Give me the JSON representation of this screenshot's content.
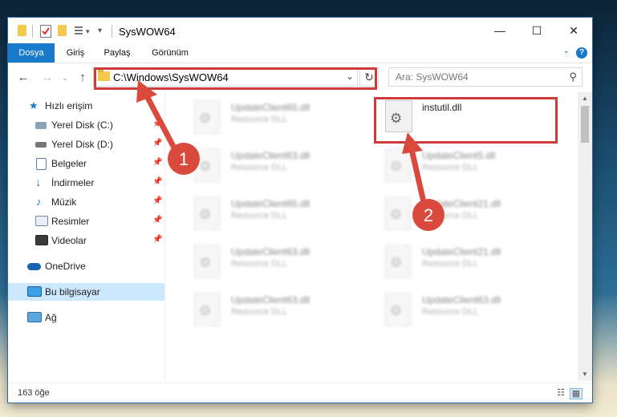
{
  "window": {
    "title": "SysWOW64",
    "controls": {
      "minimize": "—",
      "maximize": "☐",
      "close": "✕"
    }
  },
  "ribbon": {
    "tabs": [
      "Dosya",
      "Giriş",
      "Paylaş",
      "Görünüm"
    ],
    "help": "?"
  },
  "navigation": {
    "address": "C:\\Windows\\SysWOW64",
    "search_placeholder": "Ara: SysWOW64"
  },
  "sidebar": {
    "items": [
      {
        "label": "Hızlı erişim",
        "icon": "star-icon",
        "pinned": false
      },
      {
        "label": "Yerel Disk (C:)",
        "icon": "drive-icon",
        "pinned": true
      },
      {
        "label": "Yerel Disk (D:)",
        "icon": "drive-icon",
        "pinned": true
      },
      {
        "label": "Belgeler",
        "icon": "documents-icon",
        "pinned": true
      },
      {
        "label": "İndirmeler",
        "icon": "download-icon",
        "pinned": true
      },
      {
        "label": "Müzik",
        "icon": "music-icon",
        "pinned": true
      },
      {
        "label": "Resimler",
        "icon": "pictures-icon",
        "pinned": true
      },
      {
        "label": "Videolar",
        "icon": "videos-icon",
        "pinned": true
      },
      {
        "label": "OneDrive",
        "icon": "cloud-icon",
        "pinned": false
      },
      {
        "label": "Bu bilgisayar",
        "icon": "computer-icon",
        "pinned": false,
        "selected": true
      },
      {
        "label": "Ağ",
        "icon": "network-icon",
        "pinned": false
      }
    ]
  },
  "files": [
    {
      "name": "UpdateClient65.dll",
      "type": "Resource DLL",
      "blurred": true
    },
    {
      "name": "instutil.dll",
      "type": "",
      "blurred": false,
      "highlighted": true
    },
    {
      "name": "UpdateClient63.dll",
      "type": "Resource DLL",
      "blurred": true
    },
    {
      "name": "UpdateClient5.dll",
      "type": "Resource DLL",
      "blurred": true
    },
    {
      "name": "UpdateClient65.dll",
      "type": "Resource DLL",
      "blurred": true
    },
    {
      "name": "UpdateClient21.dll",
      "type": "Resource DLL",
      "blurred": true
    },
    {
      "name": "UpdateClient63.dll",
      "type": "Resource DLL",
      "blurred": true
    },
    {
      "name": "UpdateClient21.dll",
      "type": "Resource DLL",
      "blurred": true
    },
    {
      "name": "UpdateClient63.dll",
      "type": "Resource DLL",
      "blurred": true
    },
    {
      "name": "UpdateClient63.dll",
      "type": "Resource DLL",
      "blurred": true
    }
  ],
  "status": {
    "item_count": "163 öğe"
  },
  "annotations": {
    "step1": "1",
    "step2": "2",
    "highlight_color": "#cf3a3a",
    "arrow_color": "#d94a3c"
  }
}
